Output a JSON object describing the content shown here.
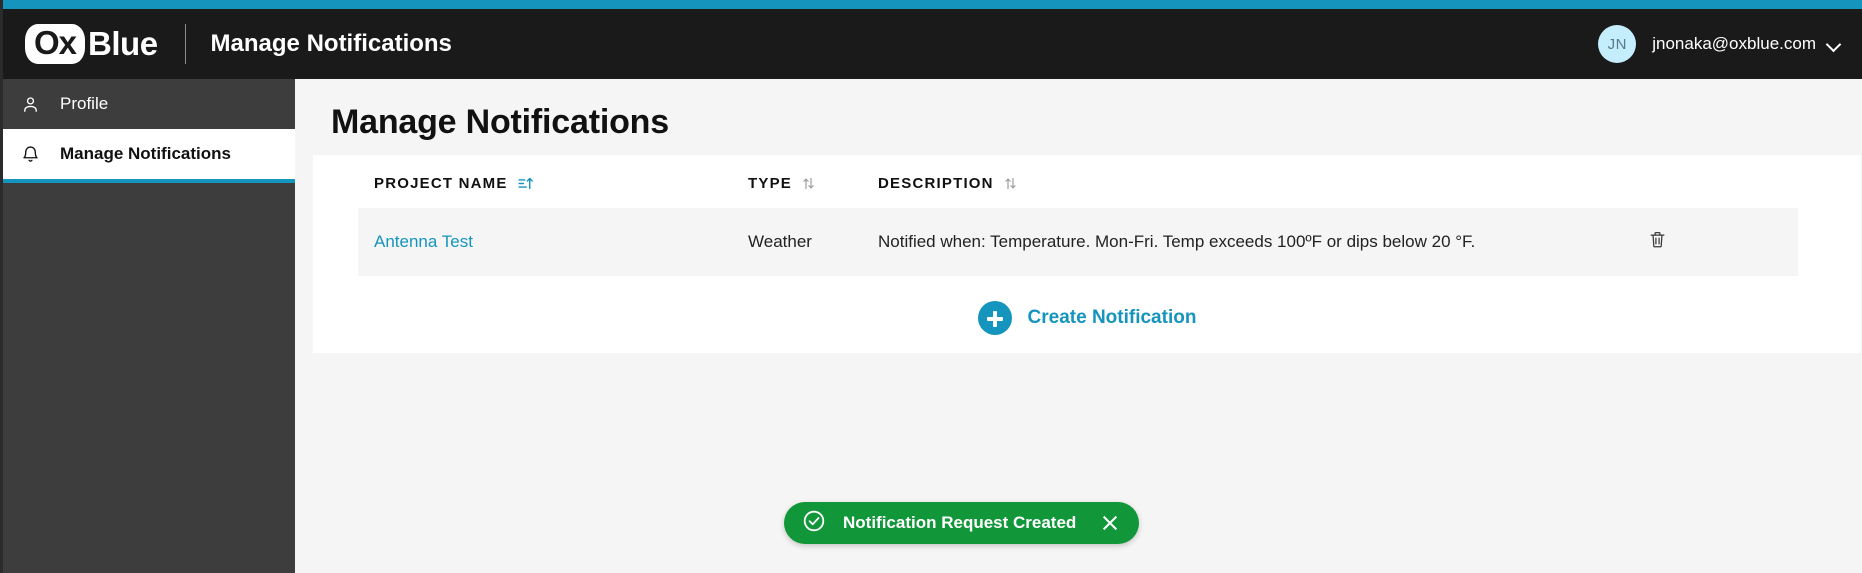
{
  "theme": {
    "accent_teal": "#1595bd",
    "header_bg": "#1a1a1a",
    "sidebar_bg": "#3d3d3d",
    "page_bg": "#f5f5f5",
    "toast_green": "#119739",
    "link_blue": "#1595bd",
    "avatar_bg": "#c5eefc"
  },
  "header": {
    "logo_ox": "Ox",
    "logo_blue": "Blue",
    "title": "Manage Notifications",
    "user": {
      "initials": "JN",
      "email": "jnonaka@oxblue.com"
    }
  },
  "sidebar": {
    "items": [
      {
        "label": "Profile",
        "icon": "user-icon",
        "active": false
      },
      {
        "label": "Manage Notifications",
        "icon": "bell-icon",
        "active": true
      }
    ]
  },
  "main": {
    "page_title": "Manage Notifications",
    "table": {
      "columns": [
        {
          "label": "PROJECT NAME",
          "sort": "ascending"
        },
        {
          "label": "TYPE",
          "sort": "none"
        },
        {
          "label": "DESCRIPTION",
          "sort": "none"
        }
      ],
      "rows": [
        {
          "project_name": "Antenna Test",
          "type": "Weather",
          "description": "Notified when: Temperature. Mon-Fri. Temp exceeds 100ºF or dips below 20 °F.",
          "delete_icon": "trash-icon"
        }
      ]
    },
    "create_button": {
      "label": "Create Notification",
      "icon": "plus-circle-icon"
    }
  },
  "toast": {
    "message": "Notification Request Created",
    "icon": "check-circle-icon",
    "close_icon": "close-icon"
  }
}
